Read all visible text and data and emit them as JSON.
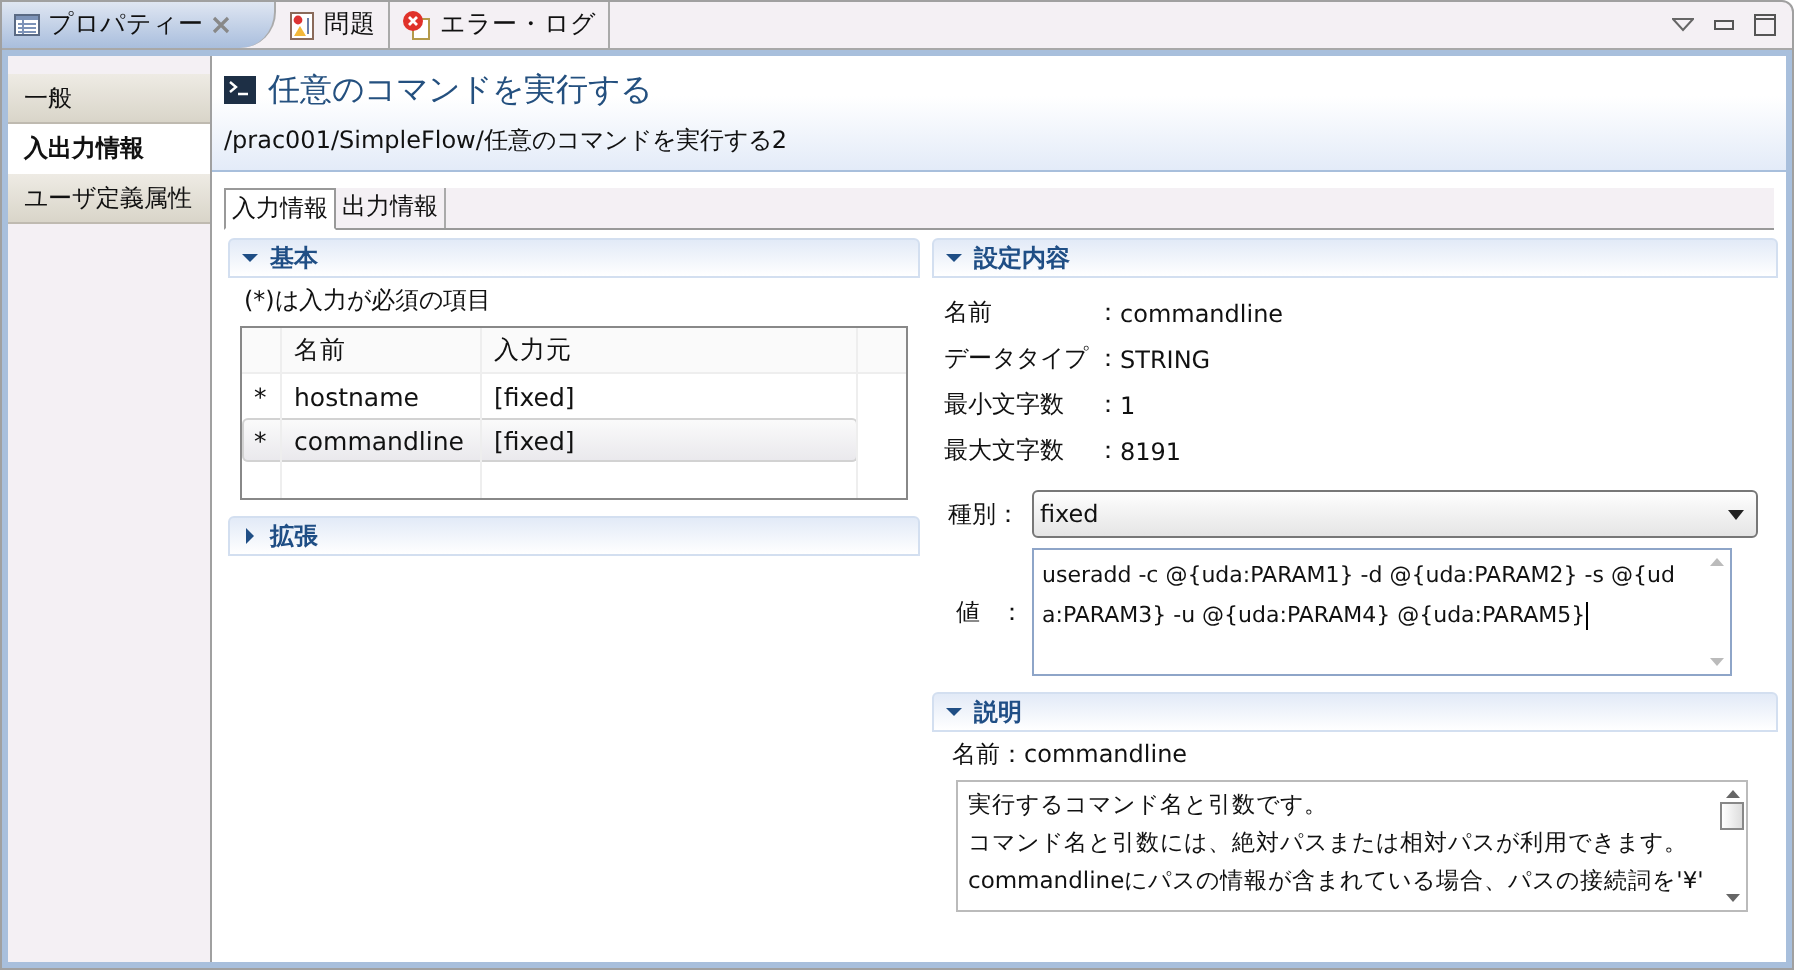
{
  "view_tabs": [
    {
      "label": "プロパティー",
      "kind": "properties",
      "selected": true,
      "closable": true
    },
    {
      "label": "問題",
      "kind": "problems",
      "selected": false,
      "closable": false
    },
    {
      "label": "エラー・ログ",
      "kind": "errorlog",
      "selected": false,
      "closable": false
    }
  ],
  "sidebar": {
    "items": [
      {
        "label": "一般",
        "selected": false
      },
      {
        "label": "入出力情報",
        "selected": true
      },
      {
        "label": "ユーザ定義属性",
        "selected": false
      }
    ]
  },
  "header": {
    "title": "任意のコマンドを実行する",
    "path": "/prac001/SimpleFlow/任意のコマンドを実行する2"
  },
  "subtabs": [
    {
      "label": "入力情報",
      "selected": true
    },
    {
      "label": "出力情報",
      "selected": false
    }
  ],
  "basic": {
    "title": "基本",
    "expanded": true,
    "note": "(*)は入力が必須の項目",
    "table": {
      "columns": [
        "名前",
        "入力元"
      ],
      "rows": [
        {
          "mark": "*",
          "name": "hostname",
          "source": "[fixed]",
          "selected": false
        },
        {
          "mark": "*",
          "name": "commandline",
          "source": "[fixed]",
          "selected": true
        }
      ]
    }
  },
  "extension": {
    "title": "拡張",
    "expanded": false
  },
  "settings": {
    "title": "設定内容",
    "expanded": true,
    "fields": [
      {
        "label": "名前",
        "sep": "：",
        "value": "commandline"
      },
      {
        "label": "データタイプ",
        "sep": "：",
        "value": "STRING"
      },
      {
        "label": "最小文字数",
        "sep": "：",
        "value": "1"
      },
      {
        "label": "最大文字数",
        "sep": "：",
        "value": "8191"
      }
    ],
    "type_select": {
      "label": "種別：",
      "value": "fixed"
    },
    "value_field": {
      "label": "値",
      "sep": "：",
      "value": "useradd -c @{uda:PARAM1} -d @{uda:PARAM2} -s @{uda:PARAM3} -u @{uda:PARAM4} @{uda:PARAM5}"
    }
  },
  "description": {
    "title": "説明",
    "expanded": true,
    "name_line": "名前：commandline",
    "lines": [
      "実行するコマンド名と引数です。",
      "コマンド名と引数には、絶対パスまたは相対パスが利用できます。",
      "commandlineにパスの情報が含まれている場合、パスの接続詞を'¥'"
    ]
  }
}
